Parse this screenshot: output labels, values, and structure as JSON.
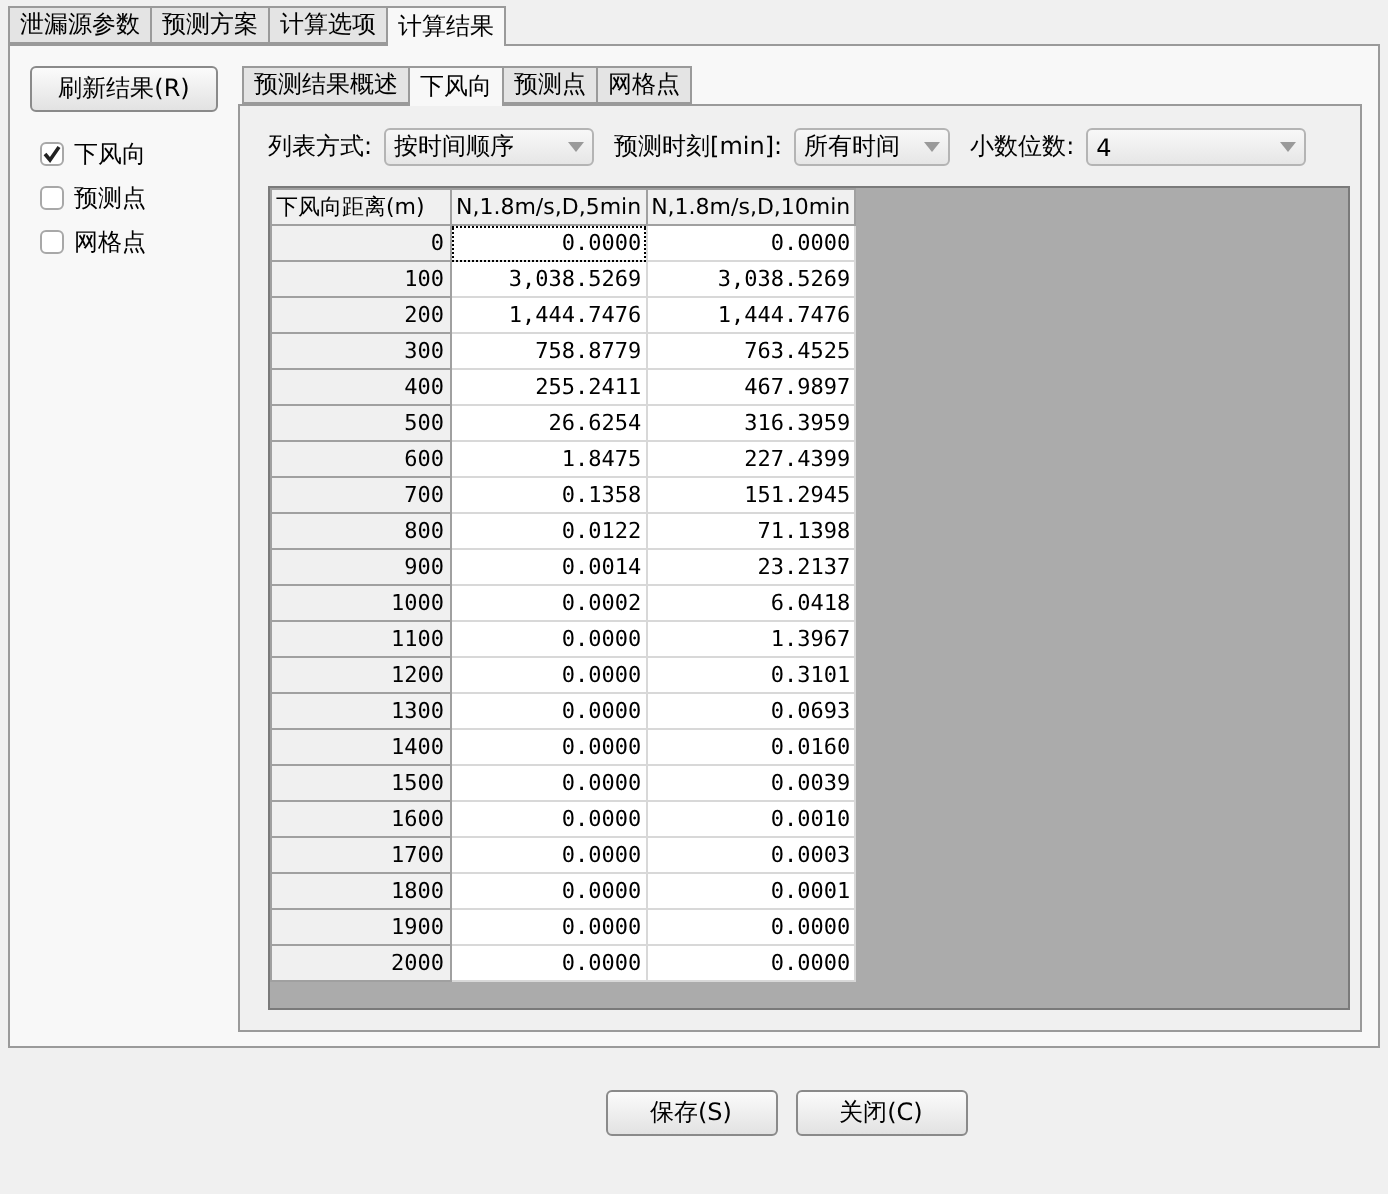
{
  "tabs": [
    {
      "label": "泄漏源参数",
      "selected": false
    },
    {
      "label": "预测方案",
      "selected": false
    },
    {
      "label": "计算选项",
      "selected": false
    },
    {
      "label": "计算结果",
      "selected": true
    }
  ],
  "refresh_button": "刷新结果(R)",
  "result_types": [
    {
      "label": "下风向",
      "checked": true
    },
    {
      "label": "预测点",
      "checked": false
    },
    {
      "label": "网格点",
      "checked": false
    }
  ],
  "sub_tabs": [
    {
      "label": "预测结果概述",
      "selected": false
    },
    {
      "label": "下风向",
      "selected": true
    },
    {
      "label": "预测点",
      "selected": false
    },
    {
      "label": "网格点",
      "selected": false
    }
  ],
  "options": [
    {
      "label": "列表方式:",
      "value": "按时间顺序"
    },
    {
      "label": "预测时刻[min]:",
      "value": "所有时间"
    },
    {
      "label": "小数位数:",
      "value": "4"
    }
  ],
  "table": {
    "columns": [
      "下风向距离(m)",
      "N,1.8m/s,D,5min",
      "N,1.8m/s,D,10min"
    ],
    "rows": [
      [
        "0",
        "0.0000",
        "0.0000"
      ],
      [
        "100",
        "3,038.5269",
        "3,038.5269"
      ],
      [
        "200",
        "1,444.7476",
        "1,444.7476"
      ],
      [
        "300",
        "758.8779",
        "763.4525"
      ],
      [
        "400",
        "255.2411",
        "467.9897"
      ],
      [
        "500",
        "26.6254",
        "316.3959"
      ],
      [
        "600",
        "1.8475",
        "227.4399"
      ],
      [
        "700",
        "0.1358",
        "151.2945"
      ],
      [
        "800",
        "0.0122",
        "71.1398"
      ],
      [
        "900",
        "0.0014",
        "23.2137"
      ],
      [
        "1000",
        "0.0002",
        "6.0418"
      ],
      [
        "1100",
        "0.0000",
        "1.3967"
      ],
      [
        "1200",
        "0.0000",
        "0.3101"
      ],
      [
        "1300",
        "0.0000",
        "0.0693"
      ],
      [
        "1400",
        "0.0000",
        "0.0160"
      ],
      [
        "1500",
        "0.0000",
        "0.0039"
      ],
      [
        "1600",
        "0.0000",
        "0.0010"
      ],
      [
        "1700",
        "0.0000",
        "0.0003"
      ],
      [
        "1800",
        "0.0000",
        "0.0001"
      ],
      [
        "1900",
        "0.0000",
        "0.0000"
      ],
      [
        "2000",
        "0.0000",
        "0.0000"
      ]
    ]
  },
  "buttons": [
    "保存(S)",
    "关闭(C)"
  ]
}
